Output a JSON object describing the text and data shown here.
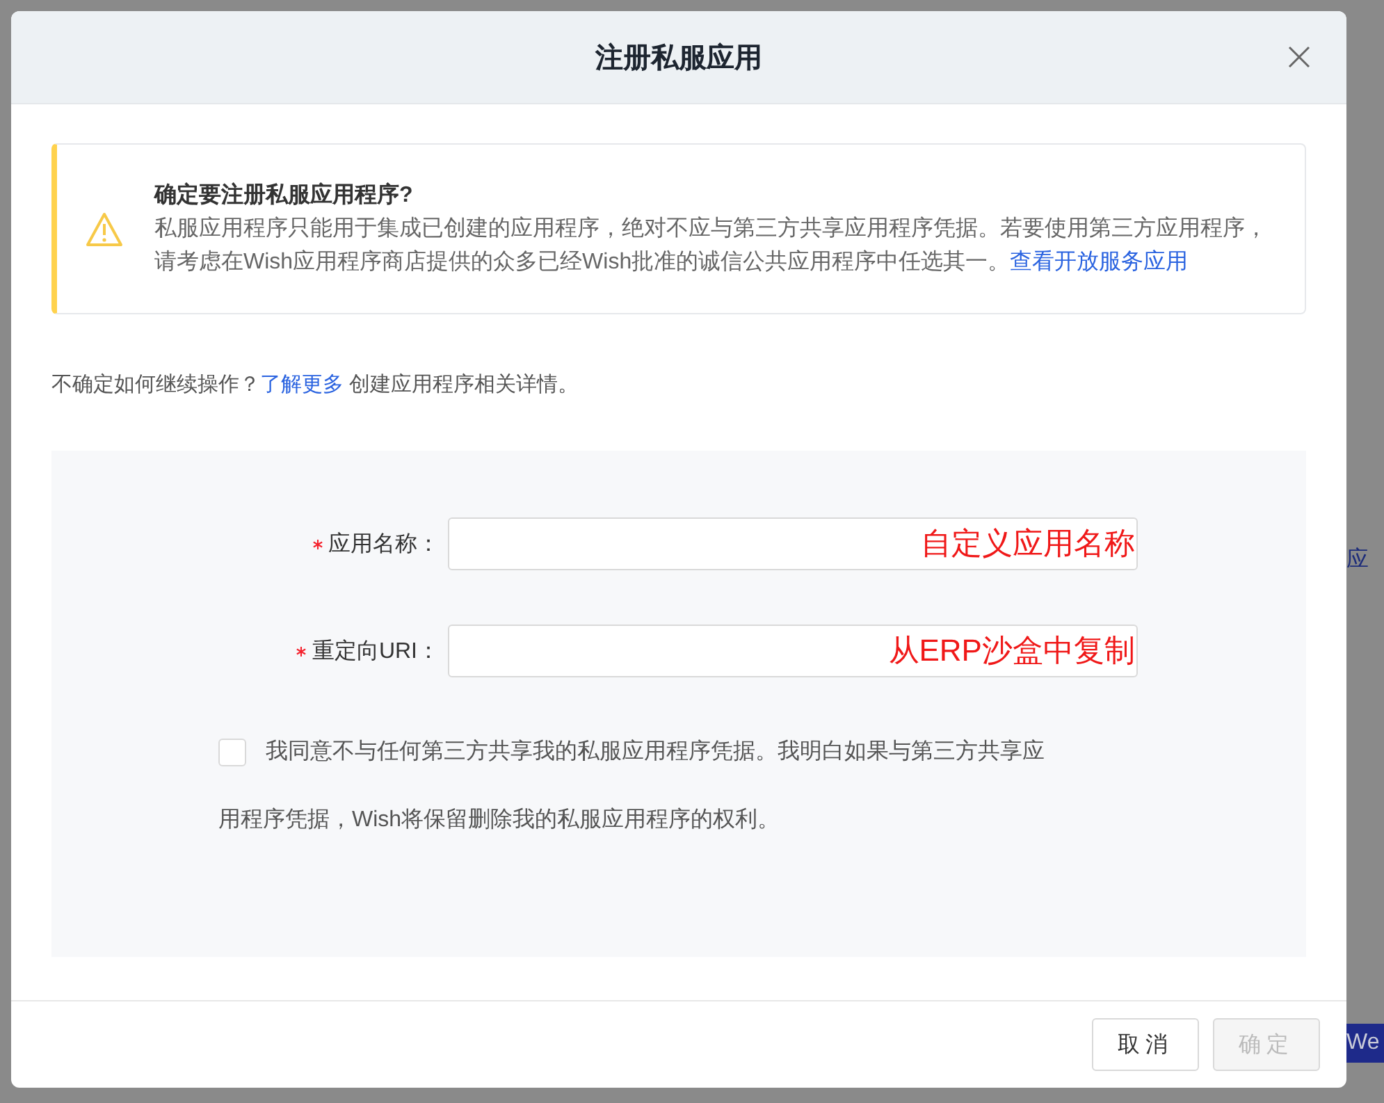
{
  "background": {
    "side_text": "应",
    "side_button": "We"
  },
  "dialog": {
    "title": "注册私服应用"
  },
  "alert": {
    "title": "确定要注册私服应用程序?",
    "body": "私服应用程序只能用于集成已创建的应用程序，绝对不应与第三方共享应用程序凭据。若要使用第三方应用程序，请考虑在Wish应用程序商店提供的众多已经Wish批准的诚信公共应用程序中任选其一。",
    "link": "查看开放服务应用"
  },
  "help": {
    "before": "不确定如何继续操作？",
    "link": "了解更多",
    "after": "创建应用程序相关详情。"
  },
  "form": {
    "fields": [
      {
        "label": "应用名称：",
        "required": true,
        "annotation": "自定义应用名称"
      },
      {
        "label": "重定向URI：",
        "required": true,
        "annotation": "从ERP沙盒中复制"
      }
    ],
    "agreement": {
      "checked": false,
      "text_lines": [
        "我同意不与任何第三方共享我的私服应用程序凭据。我明白如果与第三方共享应",
        "用程序凭据，Wish将保留删除我的私服应用程序的权利。"
      ]
    }
  },
  "buttons": [
    {
      "label": "取消",
      "disabled": false
    },
    {
      "label": "确定",
      "disabled": true
    }
  ]
}
